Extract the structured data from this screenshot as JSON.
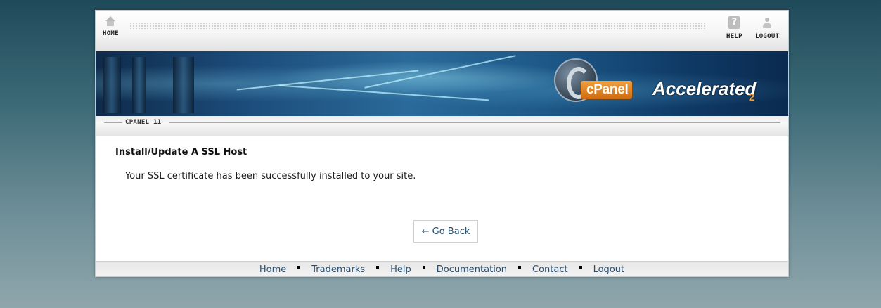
{
  "toolbar": {
    "home_label": "HOME",
    "help_label": "HELP",
    "logout_label": "LOGOUT",
    "help_icon_glyph": "?"
  },
  "banner": {
    "brand_c": "cPanel",
    "brand_accelerated": "Accelerated",
    "brand_version": "2"
  },
  "version_bar": {
    "label": "CPANEL 11"
  },
  "main": {
    "title": "Install/Update A SSL Host",
    "message": "Your SSL certificate has been successfully installed to your site.",
    "go_back_label": "← Go Back"
  },
  "footer": {
    "links": [
      "Home",
      "Trademarks",
      "Help",
      "Documentation",
      "Contact",
      "Logout"
    ]
  },
  "colors": {
    "link": "#2a4f6e",
    "brand_orange": "#e07a1a"
  }
}
